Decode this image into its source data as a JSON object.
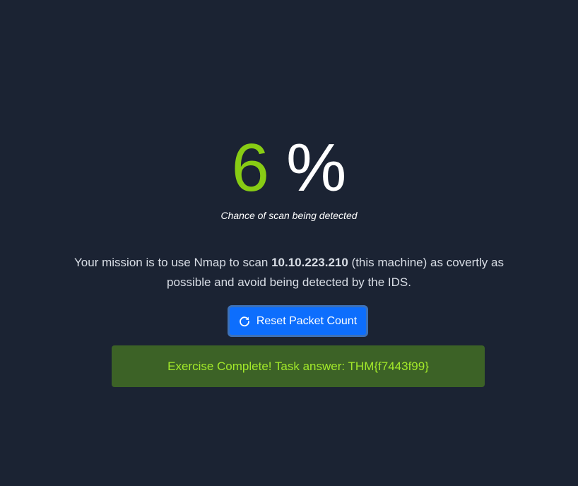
{
  "detection": {
    "value": "6",
    "unit": "%",
    "caption": "Chance of scan being detected"
  },
  "mission": {
    "text_before": "Your mission is to use Nmap to scan ",
    "target_ip": "10.10.223.210",
    "text_after": " (this machine) as covertly as possible and avoid being detected by the IDS."
  },
  "reset_button": {
    "label": "Reset Packet Count",
    "icon": "refresh-icon"
  },
  "result": {
    "message": "Exercise Complete! Task answer: THM{f7443f99}"
  },
  "colors": {
    "background": "#1b2333",
    "accent_green": "#88cc14",
    "button_blue": "#0d6efd",
    "success_bg": "#3c6226",
    "success_text": "#a3ea2a"
  }
}
